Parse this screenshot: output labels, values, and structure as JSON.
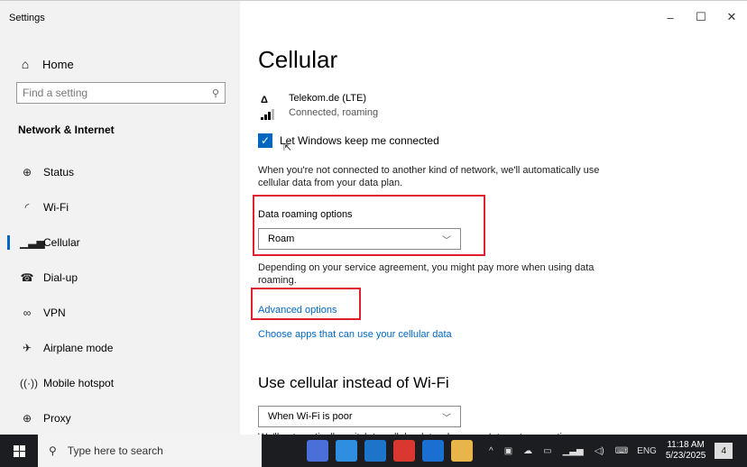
{
  "window": {
    "app_title": "Settings",
    "controls": {
      "minimize": "–",
      "maximize": "☐",
      "close": "✕"
    }
  },
  "sidebar": {
    "home_label": "Home",
    "search_placeholder": "Find a setting",
    "section_title": "Network & Internet",
    "items": [
      {
        "label": "Status",
        "icon": "globe-icon"
      },
      {
        "label": "Wi-Fi",
        "icon": "wifi-icon"
      },
      {
        "label": "Cellular",
        "icon": "cellular-icon",
        "active": true
      },
      {
        "label": "Dial-up",
        "icon": "phone-icon"
      },
      {
        "label": "VPN",
        "icon": "vpn-icon"
      },
      {
        "label": "Airplane mode",
        "icon": "airplane-icon"
      },
      {
        "label": "Mobile hotspot",
        "icon": "hotspot-icon"
      },
      {
        "label": "Proxy",
        "icon": "globe-icon"
      }
    ]
  },
  "main": {
    "title": "Cellular",
    "network": {
      "name": "Telekom.de (LTE)",
      "status": "Connected, roaming"
    },
    "keep_connected": {
      "label": "Let Windows keep me connected",
      "checked": true
    },
    "description1": "When you're not connected to another kind of network, we'll automatically use cellular data from your data plan.",
    "roaming": {
      "label": "Data roaming options",
      "value": "Roam"
    },
    "description2": "Depending on your service agreement, you might pay more when using data roaming.",
    "advanced_link": "Advanced options",
    "apps_link": "Choose apps that can use your cellular data",
    "wifi_section_title": "Use cellular instead of Wi-Fi",
    "wifi_dropdown_value": "When Wi-Fi is poor",
    "description3": "We'll automatically switch to cellular data when your Internet connection"
  },
  "taskbar": {
    "search_placeholder": "Type here to search",
    "language": "ENG",
    "time": "11:18 AM",
    "date": "5/23/2025",
    "notification_count": "4"
  },
  "colors": {
    "accent": "#0067c0",
    "highlight": "#e0202c",
    "sidebar_bg": "#f2f2f2",
    "taskbar_bg": "#1b1d21"
  }
}
